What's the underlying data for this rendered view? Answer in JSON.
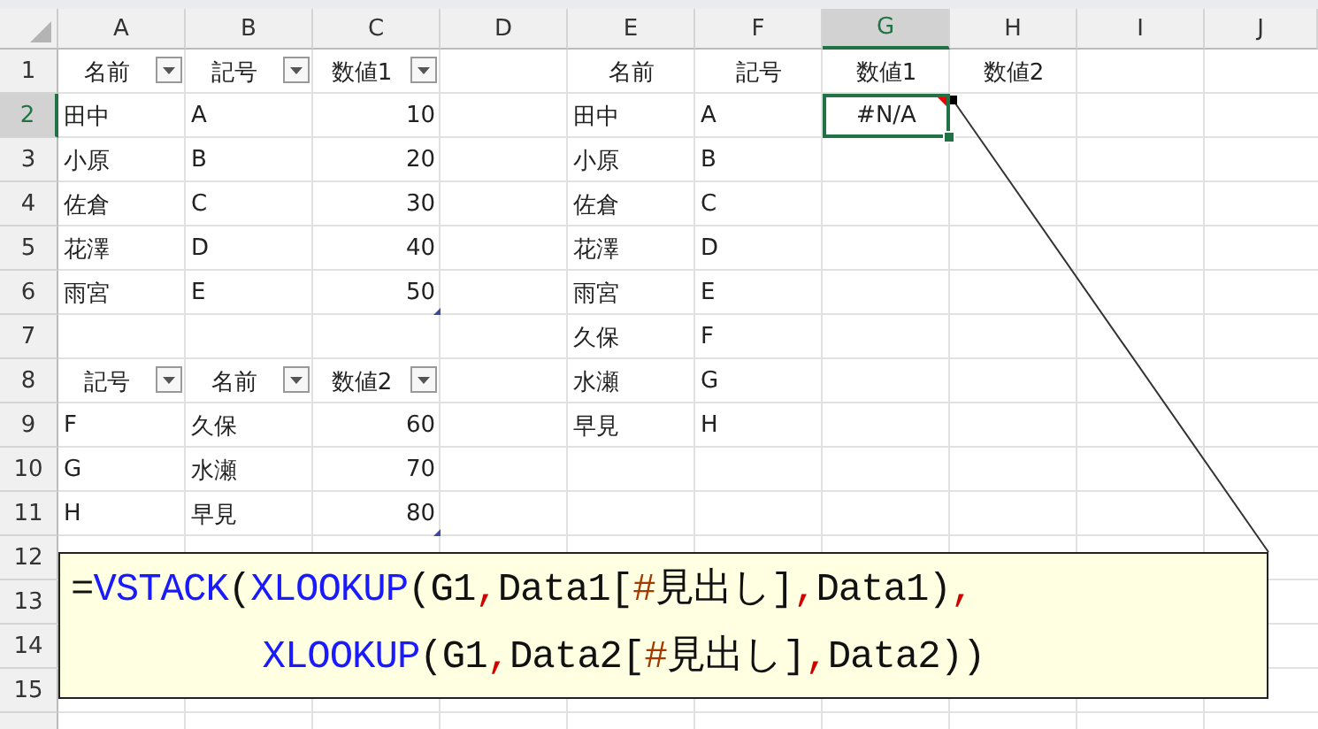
{
  "columns": [
    {
      "label": "A",
      "selected": false
    },
    {
      "label": "B",
      "selected": false
    },
    {
      "label": "C",
      "selected": false
    },
    {
      "label": "D",
      "selected": false
    },
    {
      "label": "E",
      "selected": false
    },
    {
      "label": "F",
      "selected": false
    },
    {
      "label": "G",
      "selected": true
    },
    {
      "label": "H",
      "selected": false
    },
    {
      "label": "I",
      "selected": false
    },
    {
      "label": "J",
      "selected": false
    }
  ],
  "rows": [
    {
      "number": "1",
      "selected": false,
      "cells": [
        {
          "text": "名前",
          "kind": "header",
          "filter": true
        },
        {
          "text": "記号",
          "kind": "header",
          "filter": true
        },
        {
          "text": "数値1",
          "kind": "header",
          "filter": true
        },
        {},
        {
          "text": "名前",
          "kind": "header"
        },
        {
          "text": "記号",
          "kind": "header"
        },
        {
          "text": "数値1",
          "kind": "header"
        },
        {
          "text": "数値2",
          "kind": "header"
        },
        {},
        {}
      ]
    },
    {
      "number": "2",
      "selected": true,
      "cells": [
        {
          "text": "田中",
          "kind": "text"
        },
        {
          "text": "A",
          "kind": "text"
        },
        {
          "text": "10",
          "kind": "number"
        },
        {},
        {
          "text": "田中",
          "kind": "text"
        },
        {
          "text": "A",
          "kind": "text"
        },
        {
          "text": "#N/A",
          "kind": "header",
          "selected": true,
          "error_flag": true
        },
        {},
        {},
        {}
      ]
    },
    {
      "number": "3",
      "selected": false,
      "cells": [
        {
          "text": "小原",
          "kind": "text"
        },
        {
          "text": "B",
          "kind": "text"
        },
        {
          "text": "20",
          "kind": "number"
        },
        {},
        {
          "text": "小原",
          "kind": "text"
        },
        {
          "text": "B",
          "kind": "text"
        },
        {},
        {},
        {},
        {}
      ]
    },
    {
      "number": "4",
      "selected": false,
      "cells": [
        {
          "text": "佐倉",
          "kind": "text"
        },
        {
          "text": "C",
          "kind": "text"
        },
        {
          "text": "30",
          "kind": "number"
        },
        {},
        {
          "text": "佐倉",
          "kind": "text"
        },
        {
          "text": "C",
          "kind": "text"
        },
        {},
        {},
        {},
        {}
      ]
    },
    {
      "number": "5",
      "selected": false,
      "cells": [
        {
          "text": "花澤",
          "kind": "text"
        },
        {
          "text": "D",
          "kind": "text"
        },
        {
          "text": "40",
          "kind": "number"
        },
        {},
        {
          "text": "花澤",
          "kind": "text"
        },
        {
          "text": "D",
          "kind": "text"
        },
        {},
        {},
        {},
        {}
      ]
    },
    {
      "number": "6",
      "selected": false,
      "cells": [
        {
          "text": "雨宮",
          "kind": "text"
        },
        {
          "text": "E",
          "kind": "text"
        },
        {
          "text": "50",
          "kind": "number",
          "table_end": true
        },
        {},
        {
          "text": "雨宮",
          "kind": "text"
        },
        {
          "text": "E",
          "kind": "text"
        },
        {},
        {},
        {},
        {}
      ]
    },
    {
      "number": "7",
      "selected": false,
      "cells": [
        {},
        {},
        {},
        {},
        {
          "text": "久保",
          "kind": "text"
        },
        {
          "text": "F",
          "kind": "text"
        },
        {},
        {},
        {},
        {}
      ]
    },
    {
      "number": "8",
      "selected": false,
      "cells": [
        {
          "text": "記号",
          "kind": "header",
          "filter": true
        },
        {
          "text": "名前",
          "kind": "header",
          "filter": true
        },
        {
          "text": "数値2",
          "kind": "header",
          "filter": true
        },
        {},
        {
          "text": "水瀬",
          "kind": "text"
        },
        {
          "text": "G",
          "kind": "text"
        },
        {},
        {},
        {},
        {}
      ]
    },
    {
      "number": "9",
      "selected": false,
      "cells": [
        {
          "text": "F",
          "kind": "text"
        },
        {
          "text": "久保",
          "kind": "text"
        },
        {
          "text": "60",
          "kind": "number"
        },
        {},
        {
          "text": "早見",
          "kind": "text"
        },
        {
          "text": "H",
          "kind": "text"
        },
        {},
        {},
        {},
        {}
      ]
    },
    {
      "number": "10",
      "selected": false,
      "cells": [
        {
          "text": "G",
          "kind": "text"
        },
        {
          "text": "水瀬",
          "kind": "text"
        },
        {
          "text": "70",
          "kind": "number"
        },
        {},
        {},
        {},
        {},
        {},
        {},
        {}
      ]
    },
    {
      "number": "11",
      "selected": false,
      "cells": [
        {
          "text": "H",
          "kind": "text"
        },
        {
          "text": "早見",
          "kind": "text"
        },
        {
          "text": "80",
          "kind": "number",
          "table_end": true
        },
        {},
        {},
        {},
        {},
        {},
        {},
        {}
      ]
    },
    {
      "number": "12",
      "selected": false,
      "cells": [
        {},
        {},
        {},
        {},
        {},
        {},
        {},
        {},
        {},
        {}
      ]
    },
    {
      "number": "13",
      "selected": false,
      "cells": [
        {},
        {},
        {},
        {},
        {},
        {},
        {},
        {},
        {},
        {}
      ]
    },
    {
      "number": "14",
      "selected": false,
      "cells": [
        {},
        {},
        {},
        {},
        {},
        {},
        {},
        {},
        {},
        {}
      ]
    },
    {
      "number": "15",
      "selected": false,
      "cells": [
        {},
        {},
        {},
        {},
        {},
        {},
        {},
        {},
        {},
        {}
      ]
    }
  ],
  "callout": {
    "lines": [
      [
        {
          "kind": "text",
          "text": "="
        },
        {
          "kind": "func",
          "text": "VSTACK"
        },
        {
          "kind": "text",
          "text": "("
        },
        {
          "kind": "func",
          "text": "XLOOKUP"
        },
        {
          "kind": "text",
          "text": "(G1"
        },
        {
          "kind": "comma",
          "text": ","
        },
        {
          "kind": "text",
          "text": "Data1["
        },
        {
          "kind": "hash",
          "text": "#"
        },
        {
          "kind": "text",
          "text": "見出し]"
        },
        {
          "kind": "comma",
          "text": ","
        },
        {
          "kind": "text",
          "text": "Data1)"
        },
        {
          "kind": "comma",
          "text": ","
        }
      ],
      [
        {
          "kind": "func",
          "text": "XLOOKUP"
        },
        {
          "kind": "text",
          "text": "(G1"
        },
        {
          "kind": "comma",
          "text": ","
        },
        {
          "kind": "text",
          "text": "Data2["
        },
        {
          "kind": "hash",
          "text": "#"
        },
        {
          "kind": "text",
          "text": "見出し]"
        },
        {
          "kind": "comma",
          "text": ","
        },
        {
          "kind": "text",
          "text": "Data2))"
        }
      ]
    ]
  }
}
